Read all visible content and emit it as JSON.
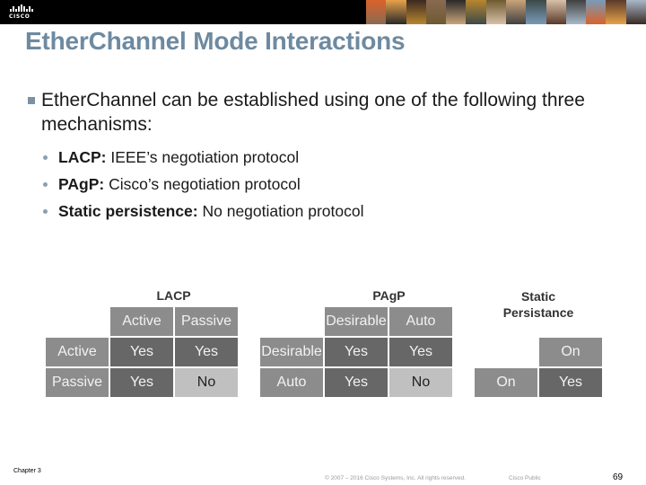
{
  "header": {
    "logo_text": "CISCO",
    "photo_strip_colors": [
      "#d9622a",
      "#e6a24a",
      "#3a2a22",
      "#8a6a52",
      "#2a2a2a",
      "#b8862e",
      "#6e5a30",
      "#c9a47a",
      "#3c4a48",
      "#d8c0a8",
      "#404040",
      "#7a9ab8",
      "#5a3a2a",
      "#a8b8c8"
    ]
  },
  "title": "EtherChannel Mode Interactions",
  "body": {
    "bullet": "EtherChannel can be established using one of the following three mechanisms:",
    "sub_bullets": [
      {
        "bold": "LACP:",
        "text": " IEEE’s negotiation protocol"
      },
      {
        "bold": "PAgP:",
        "text": " Cisco’s negotiation protocol"
      },
      {
        "bold": "Static persistence:",
        "text": " No negotiation protocol"
      }
    ]
  },
  "tables": {
    "lacp": {
      "title": "LACP",
      "col_headers": [
        "Active",
        "Passive"
      ],
      "rows": [
        {
          "header": "Active",
          "cells": [
            "Yes",
            "Yes"
          ]
        },
        {
          "header": "Passive",
          "cells": [
            "Yes",
            "No"
          ]
        }
      ]
    },
    "pagp": {
      "title": "PAgP",
      "col_headers": [
        "Desirable",
        "Auto"
      ],
      "rows": [
        {
          "header": "Desirable",
          "cells": [
            "Yes",
            "Yes"
          ]
        },
        {
          "header": "Auto",
          "cells": [
            "Yes",
            "No"
          ]
        }
      ]
    },
    "static": {
      "title_line1": "Static",
      "title_line2": "Persistance",
      "col_headers": [
        "On"
      ],
      "rows": [
        {
          "header": "On",
          "cells": [
            "Yes"
          ]
        }
      ]
    }
  },
  "footer": {
    "chapter": "Chapter 3",
    "copyright": "© 2007 – 2016 Cisco Systems, Inc. All rights reserved.",
    "classification": "Cisco Public",
    "page_number": "69"
  }
}
